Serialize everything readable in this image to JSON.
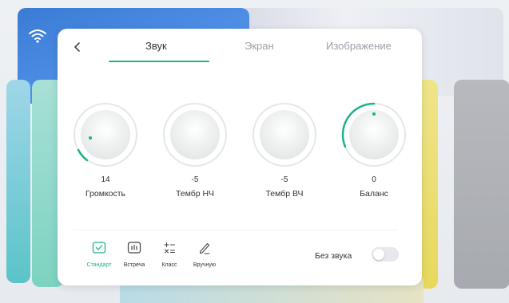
{
  "tabs": [
    {
      "label": "Звук",
      "active": true
    },
    {
      "label": "Экран",
      "active": false
    },
    {
      "label": "Изображение",
      "active": false
    }
  ],
  "knobs": [
    {
      "value": "14",
      "label": "Громкость"
    },
    {
      "value": "-5",
      "label": "Тембр НЧ"
    },
    {
      "value": "-5",
      "label": "Тембр ВЧ"
    },
    {
      "value": "0",
      "label": "Баланс"
    }
  ],
  "modes": [
    {
      "label": "Стандарт",
      "active": true,
      "icon": "check-box-icon"
    },
    {
      "label": "Встреча",
      "active": false,
      "icon": "equalizer-box-icon"
    },
    {
      "label": "Класс",
      "active": false,
      "icon": "math-symbols-icon"
    },
    {
      "label": "Вручную",
      "active": false,
      "icon": "pen-icon"
    }
  ],
  "mute": {
    "label": "Без звука",
    "on": false
  },
  "colors": {
    "accent": "#19b38d",
    "panel": "#ffffff",
    "text": "#333333",
    "muted": "#9a9ea6"
  }
}
